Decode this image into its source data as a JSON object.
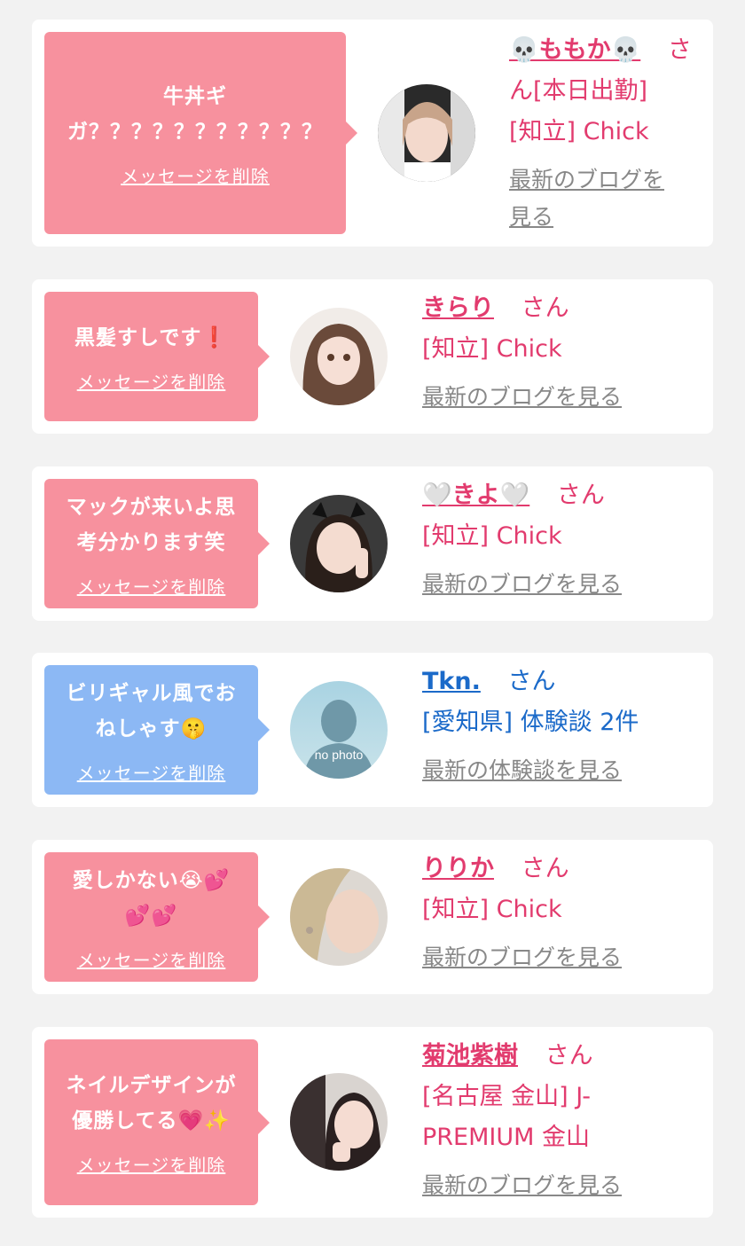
{
  "cards": [
    {
      "message_lines": [
        "牛丼ギ",
        "ガ？？？？？？？？？？？"
      ],
      "delete_label": "メッセージを削除",
      "name": "💀ももか💀",
      "suffix": "さ",
      "suffix2": "ん[本日出勤]",
      "shop": "[知立] Chick",
      "link_lines": [
        "最新のブログを",
        "見る"
      ],
      "theme": "pink"
    },
    {
      "message_lines": [
        "黒髪すしです❗"
      ],
      "delete_label": "メッセージを削除",
      "name": "きらり",
      "suffix": "さん",
      "shop": "[知立] Chick",
      "link": "最新のブログを見る",
      "theme": "pink"
    },
    {
      "message_lines": [
        "マックが来いよ思",
        "考分かります笑"
      ],
      "delete_label": "メッセージを削除",
      "name": "🤍きよ🤍",
      "suffix": "さん",
      "shop": "[知立] Chick",
      "link": "最新のブログを見る",
      "theme": "pink"
    },
    {
      "message_lines": [
        "ビリギャル風でお",
        "ねしゃす🤫"
      ],
      "delete_label": "メッセージを削除",
      "name": "Tkn.",
      "suffix": "さん",
      "shop": "[愛知県] 体験談 2件",
      "link": "最新の体験談を見る",
      "avatar_text": "no photo",
      "theme": "blue"
    },
    {
      "message_lines": [
        "愛しかない😭💕",
        "💕💕"
      ],
      "delete_label": "メッセージを削除",
      "name": "りりか",
      "suffix": "さん",
      "shop": "[知立] Chick",
      "link": "最新のブログを見る",
      "theme": "pink"
    },
    {
      "message_lines": [
        "ネイルデザインが",
        "優勝してる💗✨"
      ],
      "delete_label": "メッセージを削除",
      "name": "菊池紫樹",
      "suffix": "さん",
      "shop_lines": [
        "[名古屋 金山] J-",
        "PREMIUM 金山"
      ],
      "link": "最新のブログを見る",
      "theme": "pink"
    }
  ],
  "colors": {
    "pink_bubble": "#f7919e",
    "blue_bubble": "#8cb8f4",
    "name_pink": "#e23b6e",
    "name_blue": "#1b6ac9",
    "link_gray": "#888888"
  }
}
